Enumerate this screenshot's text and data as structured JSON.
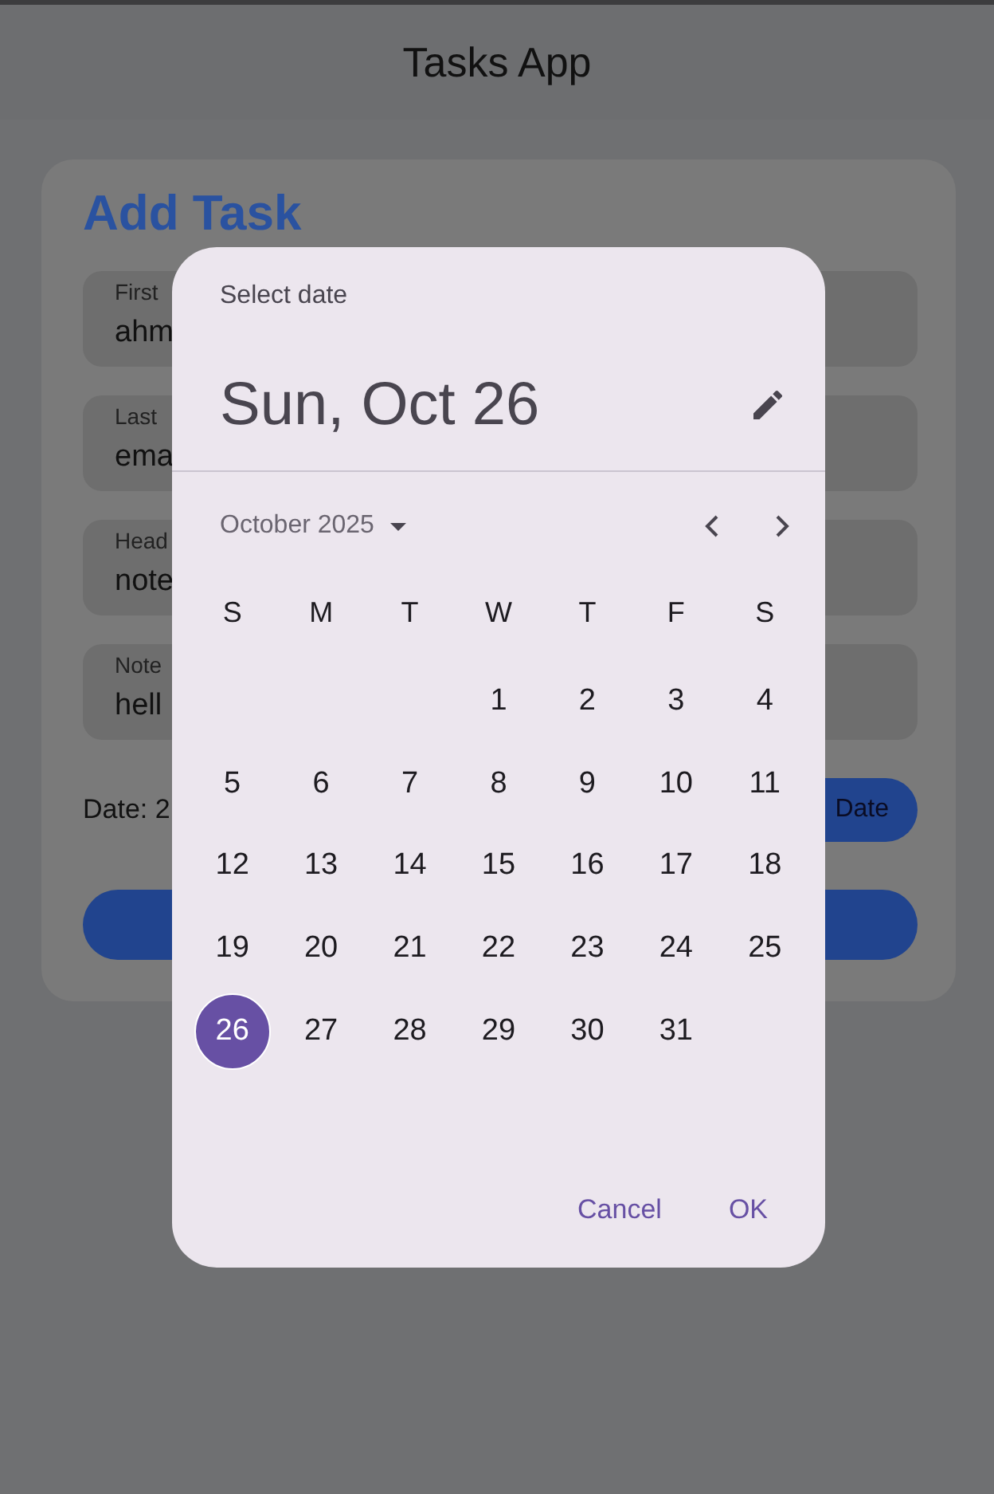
{
  "app_bar": {
    "title": "Tasks App"
  },
  "form": {
    "title": "Add Task",
    "fields": [
      {
        "label": "First",
        "value": "ahm"
      },
      {
        "label": "Last",
        "value": "ema"
      },
      {
        "label": "Head",
        "value": "note"
      },
      {
        "label": "Note",
        "value": "hell"
      }
    ],
    "date_text": "Date: 2",
    "date_button": "Date"
  },
  "dialog": {
    "header": "Select date",
    "selected_date": "Sun, Oct 26",
    "month": "October 2025",
    "weekdays": [
      "S",
      "M",
      "T",
      "W",
      "T",
      "F",
      "S"
    ],
    "weeks": [
      [
        {
          "label": "1",
          "selected": false
        },
        {
          "label": "2",
          "selected": false
        },
        {
          "label": "3",
          "selected": false
        },
        {
          "label": "4",
          "selected": false
        }
      ],
      [
        {
          "label": "5",
          "selected": false
        },
        {
          "label": "6",
          "selected": false
        },
        {
          "label": "7",
          "selected": false
        },
        {
          "label": "8",
          "selected": false
        },
        {
          "label": "9",
          "selected": false
        },
        {
          "label": "10",
          "selected": false
        },
        {
          "label": "11",
          "selected": false
        }
      ],
      [
        {
          "label": "12",
          "selected": false
        },
        {
          "label": "13",
          "selected": false
        },
        {
          "label": "14",
          "selected": false
        },
        {
          "label": "15",
          "selected": false
        },
        {
          "label": "16",
          "selected": false
        },
        {
          "label": "17",
          "selected": false
        },
        {
          "label": "18",
          "selected": false
        }
      ],
      [
        {
          "label": "19",
          "selected": false
        },
        {
          "label": "20",
          "selected": false
        },
        {
          "label": "21",
          "selected": false
        },
        {
          "label": "22",
          "selected": false
        },
        {
          "label": "23",
          "selected": false
        },
        {
          "label": "24",
          "selected": false
        },
        {
          "label": "25",
          "selected": false
        }
      ],
      [
        {
          "label": "26",
          "selected": true
        },
        {
          "label": "27",
          "selected": false
        },
        {
          "label": "28",
          "selected": false
        },
        {
          "label": "29",
          "selected": false
        },
        {
          "label": "30",
          "selected": false
        },
        {
          "label": "31",
          "selected": false
        }
      ]
    ],
    "actions": [
      "Cancel",
      "OK"
    ]
  }
}
